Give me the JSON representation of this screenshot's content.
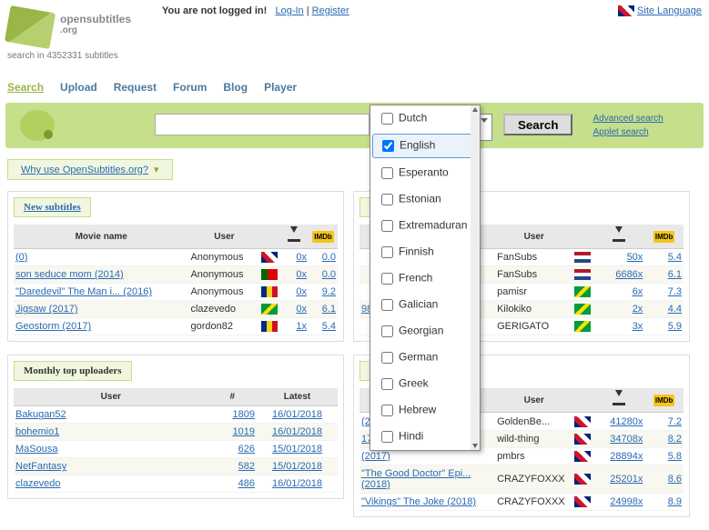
{
  "header": {
    "site_name": "opensubtitles",
    "site_suffix": ".org",
    "tagline": "search in 4352331 subtitles",
    "login_prefix": "You are not logged in!",
    "login_link": "Log-In",
    "register_link": "Register",
    "site_lang": "Site Language"
  },
  "nav": [
    "Search",
    "Upload",
    "Request",
    "Forum",
    "Blog",
    "Player"
  ],
  "search": {
    "placeholder": "",
    "lang_selected": "English",
    "button": "Search",
    "advanced": "Advanced search",
    "applet": "Applet search"
  },
  "why": "Why use OpenSubtitles.org?",
  "dropdown": {
    "options": [
      "Dutch",
      "English",
      "Esperanto",
      "Estonian",
      "Extremaduran",
      "Finnish",
      "French",
      "Galician",
      "Georgian",
      "German",
      "Greek",
      "Hebrew",
      "Hindi"
    ],
    "selected": "English"
  },
  "left1": {
    "title": "New subtitles",
    "head": [
      "Movie name",
      "User",
      "",
      ""
    ],
    "rows": [
      {
        "name": "(0)",
        "user": "Anonymous",
        "flag": "gb",
        "dl": "0x",
        "r": "0.0"
      },
      {
        "name": "son seduce mom (2014)",
        "user": "Anonymous",
        "flag": "pt",
        "dl": "0x",
        "r": "0.0"
      },
      {
        "name": "\"Daredevil\" The Man i... (2016)",
        "user": "Anonymous",
        "flag": "ro",
        "dl": "0x",
        "r": "9.2"
      },
      {
        "name": "Jigsaw (2017)",
        "user": "clazevedo",
        "flag": "br",
        "dl": "0x",
        "r": "6.1"
      },
      {
        "name": "Geostorm (2017)",
        "user": "gordon82",
        "flag": "ro",
        "dl": "1x",
        "r": "5.4"
      }
    ]
  },
  "left2": {
    "title": "Monthly top uploaders",
    "head": [
      "User",
      "#",
      "Latest"
    ],
    "rows": [
      {
        "u": "Bakugan52",
        "n": "1809",
        "d": "16/01/2018"
      },
      {
        "u": "bohemio1",
        "n": "1019",
        "d": "16/01/2018"
      },
      {
        "u": "MaSousa",
        "n": "626",
        "d": "15/01/2018"
      },
      {
        "u": "NetFantasy",
        "n": "582",
        "d": "15/01/2018"
      },
      {
        "u": "clazevedo",
        "n": "486",
        "d": "16/01/2018"
      }
    ]
  },
  "right1": {
    "title_suffix": "e",
    "head_user": "User",
    "rows": [
      {
        "user": "FanSubs",
        "flag": "nl",
        "dl": "50x",
        "r": "5.4"
      },
      {
        "user": "FanSubs",
        "flag": "nl",
        "dl": "6686x",
        "r": "6.1"
      },
      {
        "user": "pamisr",
        "flag": "br",
        "dl": "6x",
        "r": "7.3"
      },
      {
        "name": "980)",
        "user": "Kilokiko",
        "flag": "br",
        "dl": "2x",
        "r": "4.4"
      },
      {
        "user": "GERIGATO",
        "flag": "br",
        "dl": "3x",
        "r": "5.9"
      }
    ]
  },
  "right2": {
    "title_suffix": "subtitles",
    "head_user": "User",
    "rows": [
      {
        "name": "(2018)",
        "user": "GoldenBe...",
        "flag": "gb",
        "dl": "41280x",
        "r": "7.2"
      },
      {
        "name": "17)",
        "user": "wild-thing",
        "flag": "gb",
        "dl": "34708x",
        "r": "8.2"
      },
      {
        "name": "(2017)",
        "user": "pmbrs",
        "flag": "gb",
        "dl": "28894x",
        "r": "5.8"
      },
      {
        "name": "\"The Good Doctor\" Epi... (2018)",
        "user": "CRAZYFOXXX",
        "flag": "gb",
        "dl": "25201x",
        "r": "8.6"
      },
      {
        "name": "\"Vikings\" The Joke (2018)",
        "user": "CRAZYFOXXX",
        "flag": "gb",
        "dl": "24998x",
        "r": "8.9"
      }
    ]
  }
}
